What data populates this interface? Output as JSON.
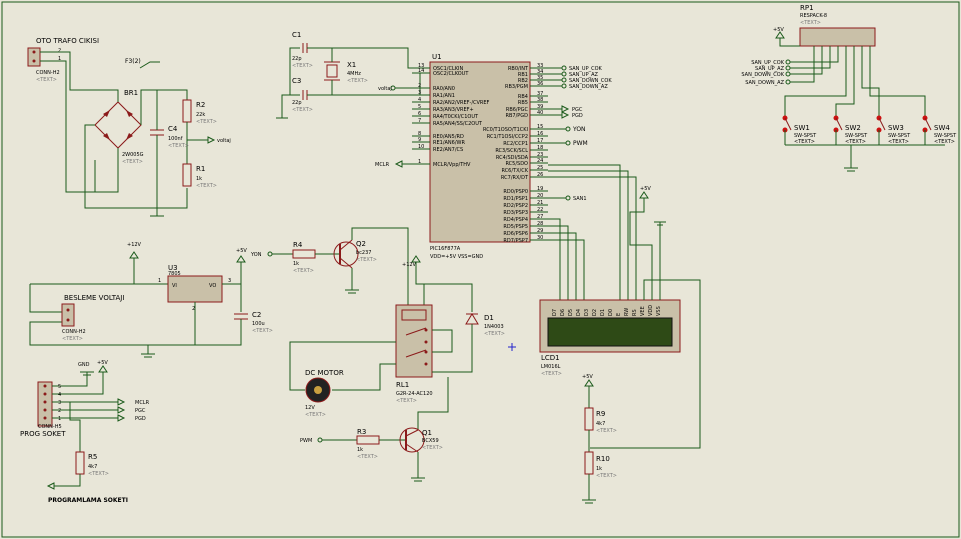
{
  "trafo": {
    "label": "OTO TRAFO CIKISI",
    "conn": "CONN-H2",
    "pin1": "1",
    "pin2": "2"
  },
  "fuse": {
    "label": "F3(2)"
  },
  "br1": {
    "label": "BR1",
    "part": "2W005G"
  },
  "r2": {
    "label": "R2",
    "value": "22k"
  },
  "r1": {
    "label": "R1",
    "value": "1k"
  },
  "c4": {
    "label": "C4",
    "value": "100nf"
  },
  "voltaj1": "voltaj",
  "c1": {
    "label": "C1",
    "value": "22p"
  },
  "c3": {
    "label": "C3",
    "value": "22p"
  },
  "x1": {
    "label": "X1",
    "value": "4MHz"
  },
  "u1": {
    "label": "U1",
    "part": "PIC16F877A",
    "pins_note": "VDD=+5V\nVSS=GND",
    "left_pins": [
      {
        "num": "13",
        "name": "OSC1/CLKIN"
      },
      {
        "num": "14",
        "name": "OSC2/CLKOUT"
      },
      {
        "num": "2",
        "name": "RA0/AN0"
      },
      {
        "num": "3",
        "name": "RA1/AN1"
      },
      {
        "num": "4",
        "name": "RA2/AN2/VREF-/CVREF"
      },
      {
        "num": "5",
        "name": "RA3/AN3/VREF+"
      },
      {
        "num": "6",
        "name": "RA4/T0CKI/C1OUT"
      },
      {
        "num": "7",
        "name": "RA5/AN4/SS/C2OUT"
      },
      {
        "num": "8",
        "name": "RE0/AN5/RD"
      },
      {
        "num": "9",
        "name": "RE1/AN6/WR"
      },
      {
        "num": "10",
        "name": "RE2/AN7/CS"
      },
      {
        "num": "1",
        "name": "MCLR/Vpp/THV"
      }
    ],
    "right_pins": [
      {
        "num": "33",
        "name": "RB0/INT"
      },
      {
        "num": "34",
        "name": "RB1"
      },
      {
        "num": "35",
        "name": "RB2"
      },
      {
        "num": "36",
        "name": "RB3/PGM"
      },
      {
        "num": "37",
        "name": "RB4"
      },
      {
        "num": "38",
        "name": "RB5"
      },
      {
        "num": "39",
        "name": "RB6/PGC"
      },
      {
        "num": "40",
        "name": "RB7/PGD"
      },
      {
        "num": "15",
        "name": "RC0/T1OSO/T1CKI"
      },
      {
        "num": "16",
        "name": "RC1/T1OSI/CCP2"
      },
      {
        "num": "17",
        "name": "RC2/CCP1"
      },
      {
        "num": "18",
        "name": "RC3/SCK/SCL"
      },
      {
        "num": "23",
        "name": "RC4/SDI/SDA"
      },
      {
        "num": "24",
        "name": "RC5/SDO"
      },
      {
        "num": "25",
        "name": "RC6/TX/CK"
      },
      {
        "num": "26",
        "name": "RC7/RX/DT"
      },
      {
        "num": "19",
        "name": "RD0/PSP0"
      },
      {
        "num": "20",
        "name": "RD1/PSP1"
      },
      {
        "num": "21",
        "name": "RD2/PSP2"
      },
      {
        "num": "22",
        "name": "RD3/PSP3"
      },
      {
        "num": "27",
        "name": "RD4/PSP4"
      },
      {
        "num": "28",
        "name": "RD5/PSP5"
      },
      {
        "num": "29",
        "name": "RD6/PSP6"
      },
      {
        "num": "30",
        "name": "RD7/PSP7"
      }
    ],
    "net_rb0": "SAN_UP_COK",
    "net_rb1": "SAN_UP_AZ",
    "net_rb2": "SAN_DOWN_COK",
    "net_rb3": "SAN_DOWN_AZ",
    "net_rb6": "PGC",
    "net_rb7": "PGD",
    "net_rc0": "YON",
    "net_rc2": "PWM",
    "net_rd1": "SAN1",
    "net_voltaj": "voltaj",
    "net_mclr": "MCLR"
  },
  "rp1": {
    "label": "RP1",
    "part": "RESPACK-8"
  },
  "rp_nets": [
    "SAN_UP_COK",
    "SAN_UP_AZ",
    "SAN_DOWN_COK",
    "SAN_DOWN_AZ"
  ],
  "switches": [
    {
      "label": "SW1",
      "part": "SW-SPST"
    },
    {
      "label": "SW2",
      "part": "SW-SPST"
    },
    {
      "label": "SW3",
      "part": "SW-SPST"
    },
    {
      "label": "SW4",
      "part": "SW-SPST"
    }
  ],
  "sw_supply": "+5V",
  "lcd": {
    "label": "LCD1",
    "part": "LM016L",
    "pins": [
      "D7",
      "D6",
      "D5",
      "D4",
      "D3",
      "D2",
      "D1",
      "D0",
      "E",
      "RW",
      "RS",
      "VEE",
      "VDD",
      "VSS"
    ],
    "supply": "+5V"
  },
  "r9": {
    "label": "R9",
    "value": "4k7"
  },
  "r10": {
    "label": "R10",
    "value": "1k"
  },
  "r9_supply": "+5V",
  "u3": {
    "label": "U3",
    "part": "7805",
    "vi": "VI",
    "vo": "VO",
    "pin1": "1",
    "pin3": "3",
    "pin2": "2"
  },
  "c2": {
    "label": "C2",
    "value": "100u"
  },
  "u3_in": "+12V",
  "u3_out": "+5V",
  "besleme": {
    "label": "BESLEME VOLTAJI",
    "conn": "CONN-H2"
  },
  "r4": {
    "label": "R4",
    "value": "1k"
  },
  "q2": {
    "label": "Q2",
    "part": "bc237"
  },
  "yon_net": "YON",
  "relay_supply": "+12V",
  "rl1": {
    "label": "RL1",
    "part": "G2R-24-AC120"
  },
  "d1": {
    "label": "D1",
    "part": "1N4003"
  },
  "motor": {
    "label": "DC MOTOR",
    "value": "12V"
  },
  "r3": {
    "label": "R3",
    "value": "1k"
  },
  "q1": {
    "label": "Q1",
    "part": "BCX59"
  },
  "pwm_net": "PWM",
  "prog": {
    "label": "PROG SOKET",
    "conn": "CONN-H5",
    "gnd": "GND",
    "vcc": "+5V",
    "mclr": "MCLR",
    "pgc": "PGC",
    "pgd": "PGD",
    "pins": [
      "1",
      "2",
      "3",
      "4",
      "5"
    ]
  },
  "r5": {
    "label": "R5",
    "value": "4k7"
  },
  "prog_title": "PROGRAMLAMA SOKETI",
  "text_placeholder": "<TEXT>",
  "colors": {
    "background": "#e8e6d8",
    "wire": "#1a5a1a",
    "part": "#8b1a1a",
    "ic_fill": "#c9c0a8",
    "lcd_screen": "#2e4a16",
    "title_red": "#cc1111"
  }
}
